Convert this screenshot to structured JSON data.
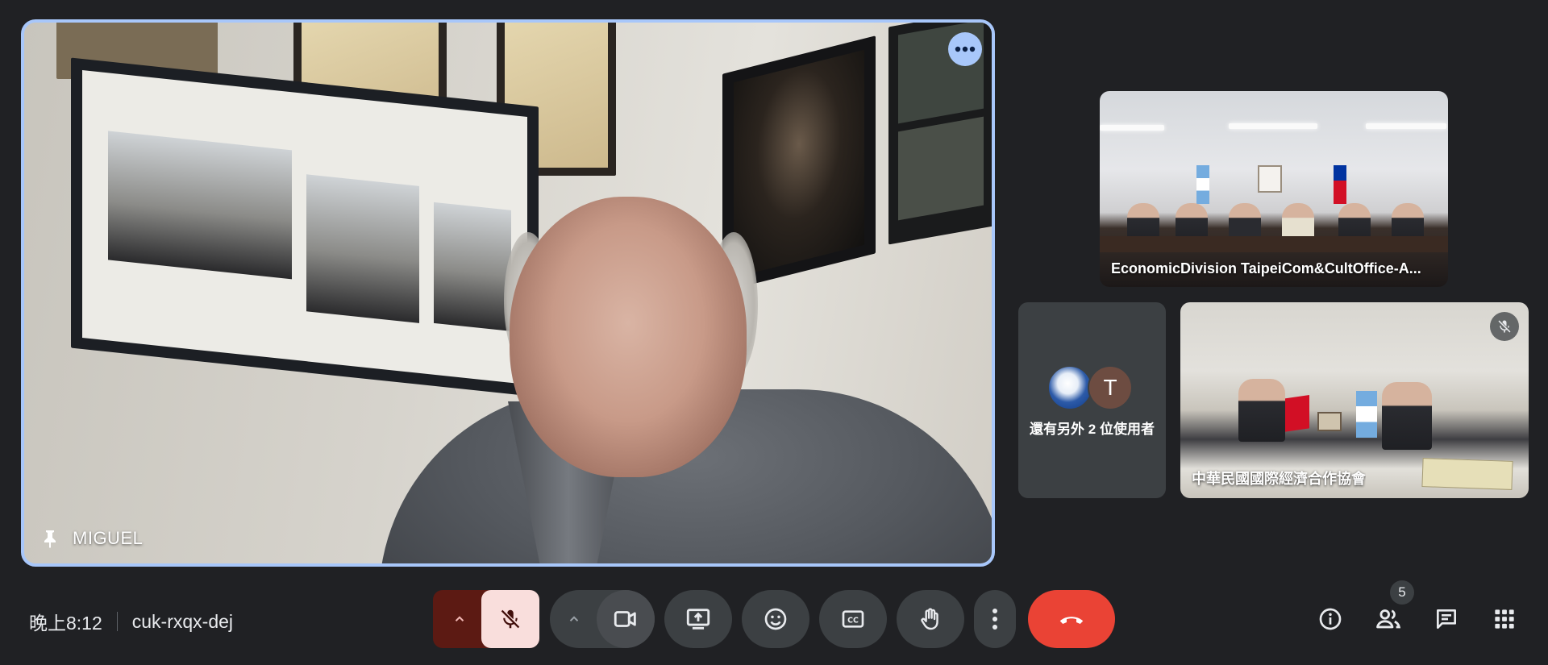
{
  "main_tile": {
    "participant_name": "MIGUEL"
  },
  "tiles": [
    {
      "label": "EconomicDivision TaipeiCom&CultOffice-A..."
    },
    {
      "label": "還有另外 2 位使用者",
      "avatar_letter": "T"
    },
    {
      "label": "中華民國國際經濟合作協會"
    }
  ],
  "meeting": {
    "time": "晚上8:12",
    "code": "cuk-rxqx-dej"
  },
  "participants_count": "5",
  "colors": {
    "accent": "#a8c7fa",
    "end_call": "#ea4335",
    "mic_off_bg": "#f9dedc",
    "mic_off_group": "#5c1a13",
    "button_bg": "#3c4043",
    "background": "#202124"
  },
  "icons": {
    "more": "more-horiz-icon",
    "pin": "pin-icon",
    "mic_off": "mic-off-icon",
    "camera": "videocam-icon",
    "present": "present-screen-icon",
    "emoji": "emoji-icon",
    "captions": "captions-icon",
    "raise_hand": "raise-hand-icon",
    "more_options": "more-vert-icon",
    "end_call": "call-end-icon",
    "info": "info-icon",
    "people": "people-icon",
    "chat": "chat-icon",
    "activities": "apps-grid-icon"
  }
}
